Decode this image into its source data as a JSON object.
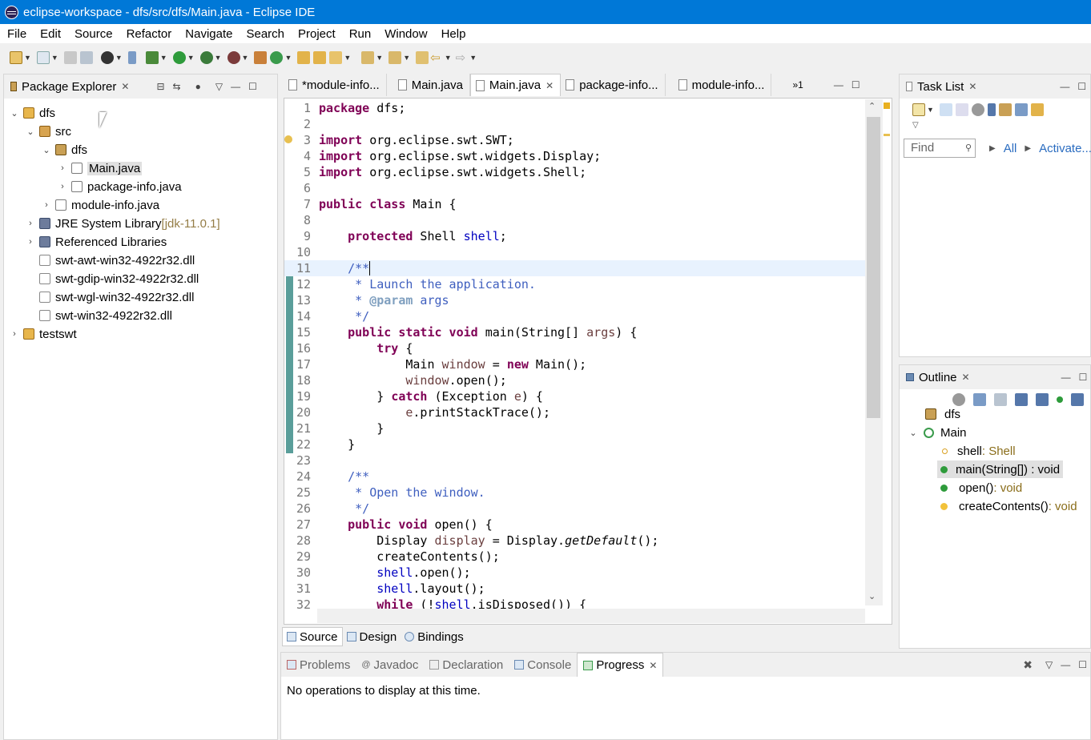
{
  "window": {
    "title": "eclipse-workspace - dfs/src/dfs/Main.java - Eclipse IDE"
  },
  "menu": [
    "File",
    "Edit",
    "Source",
    "Refactor",
    "Navigate",
    "Search",
    "Project",
    "Run",
    "Window",
    "Help"
  ],
  "package_explorer": {
    "title": "Package Explorer",
    "tree": [
      {
        "label": "dfs",
        "depth": 0,
        "expanded": true,
        "icon": "project-icon"
      },
      {
        "label": "src",
        "depth": 1,
        "expanded": true,
        "icon": "source-folder-icon"
      },
      {
        "label": "dfs",
        "depth": 2,
        "expanded": true,
        "icon": "package-icon"
      },
      {
        "label": "Main.java",
        "depth": 3,
        "expanded": false,
        "icon": "java-file-icon",
        "selected": true
      },
      {
        "label": "package-info.java",
        "depth": 3,
        "expanded": false,
        "icon": "java-file-icon"
      },
      {
        "label": "module-info.java",
        "depth": 2,
        "expanded": false,
        "icon": "java-file-icon"
      },
      {
        "label": "JRE System Library",
        "suffix": "[jdk-11.0.1]",
        "depth": 1,
        "expanded": false,
        "icon": "library-icon"
      },
      {
        "label": "Referenced Libraries",
        "depth": 1,
        "expanded": false,
        "icon": "library-icon"
      },
      {
        "label": "swt-awt-win32-4922r32.dll",
        "depth": 1,
        "icon": "file-icon"
      },
      {
        "label": "swt-gdip-win32-4922r32.dll",
        "depth": 1,
        "icon": "file-icon"
      },
      {
        "label": "swt-wgl-win32-4922r32.dll",
        "depth": 1,
        "icon": "file-icon"
      },
      {
        "label": "swt-win32-4922r32.dll",
        "depth": 1,
        "icon": "file-icon"
      },
      {
        "label": "testswt",
        "depth": 0,
        "expanded": false,
        "icon": "project-icon"
      }
    ]
  },
  "editor": {
    "tabs": [
      {
        "label": "*module-info...",
        "active": false
      },
      {
        "label": "Main.java",
        "active": false
      },
      {
        "label": "Main.java",
        "active": true
      },
      {
        "label": "package-info...",
        "active": false
      },
      {
        "label": "module-info...",
        "active": false
      }
    ],
    "overflow_label": "»1",
    "lines": [
      "1",
      "2",
      "3",
      "4",
      "5",
      "6",
      "7",
      "8",
      "9",
      "10",
      "11",
      "12",
      "13",
      "14",
      "15",
      "16",
      "17",
      "18",
      "19",
      "20",
      "21",
      "22",
      "23",
      "24",
      "25",
      "26",
      "27",
      "28",
      "29",
      "30",
      "31",
      "32"
    ],
    "bottom_tabs": [
      "Source",
      "Design",
      "Bindings"
    ]
  },
  "task_list": {
    "title": "Task List",
    "find_placeholder": "Find",
    "all_label": "All",
    "activate_label": "Activate..."
  },
  "outline": {
    "title": "Outline",
    "items": [
      {
        "label": "dfs",
        "type": ""
      },
      {
        "label": "Main",
        "type": ""
      },
      {
        "label": "shell",
        "type": " : Shell"
      },
      {
        "label": "main(String[]) : void",
        "type": ""
      },
      {
        "label": "open()",
        "type": " : void"
      },
      {
        "label": "createContents()",
        "type": " : void"
      }
    ]
  },
  "console": {
    "tabs": [
      "Problems",
      "Javadoc",
      "Declaration",
      "Console",
      "Progress"
    ],
    "message": "No operations to display at this time."
  }
}
